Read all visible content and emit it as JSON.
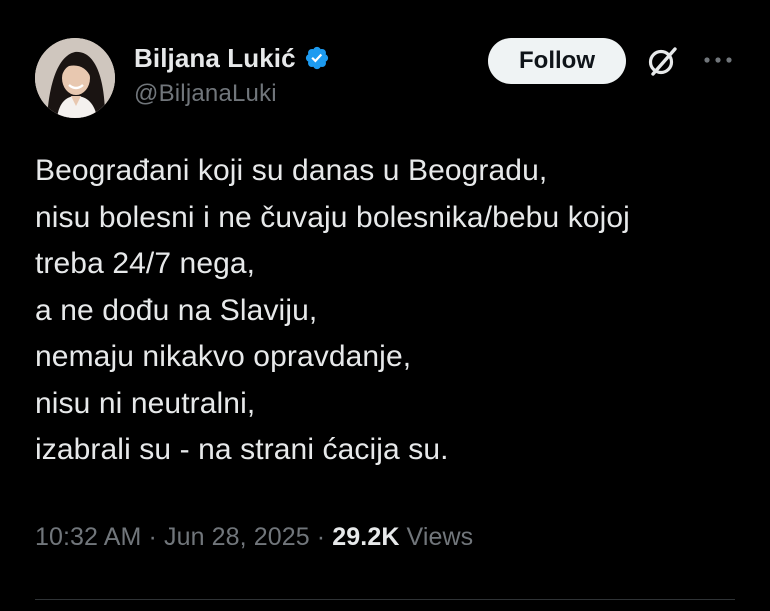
{
  "author": {
    "display_name": "Biljana Lukić",
    "handle": "@BiljanaLuki",
    "verified": true
  },
  "actions": {
    "follow_label": "Follow",
    "grok_icon": "grok-icon",
    "more_icon": "more-icon"
  },
  "tweet": {
    "lines": [
      "Beograđani koji su danas u Beogradu,",
      "nisu bolesni i ne čuvaju bolesnika/bebu kojoj",
      "treba 24/7 nega,",
      "a ne dođu na Slaviju,",
      "nemaju nikakvo opravdanje,",
      "nisu ni neutralni,",
      "izabrali su - na strani ćacija su."
    ]
  },
  "meta": {
    "time": "10:32 AM",
    "separator": "·",
    "date": "Jun 28, 2025",
    "views_count": "29.2K",
    "views_label": "Views"
  },
  "colors": {
    "background": "#000000",
    "text_primary": "#e7e9ea",
    "text_secondary": "#71767b",
    "verified_badge": "#1d9bf0",
    "follow_button_bg": "#eff3f4",
    "divider": "#2f3336"
  }
}
